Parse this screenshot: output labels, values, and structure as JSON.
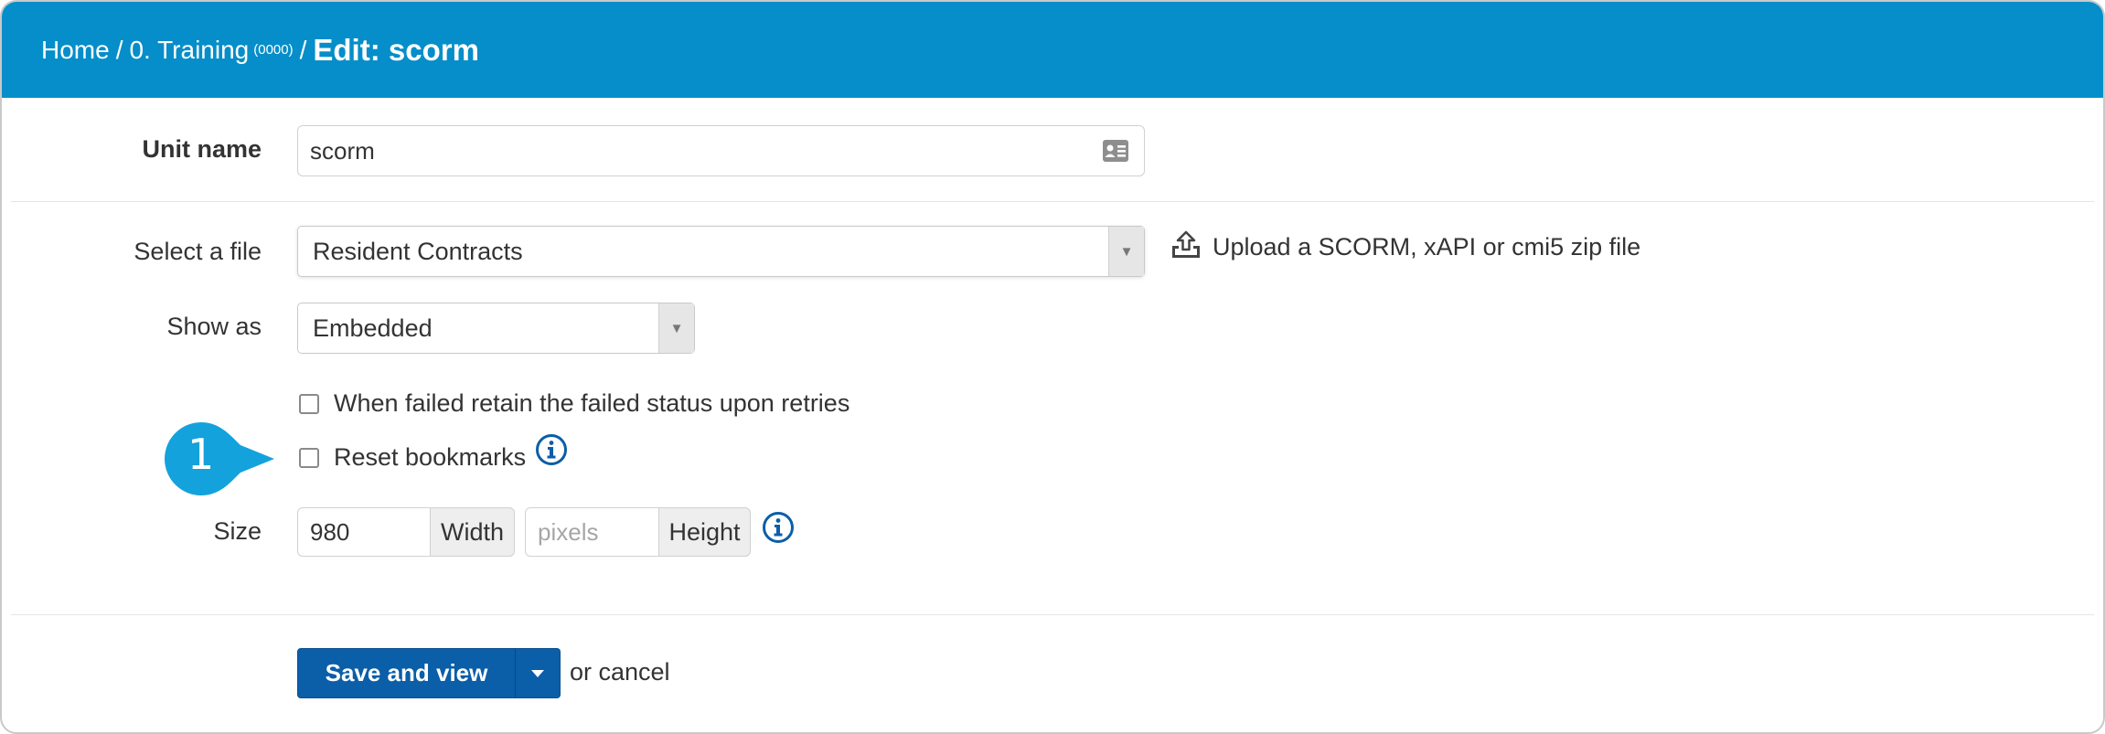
{
  "breadcrumb": {
    "home": "Home",
    "separator": "/",
    "course": "0. Training",
    "course_code": "(0000)",
    "title": "Edit: scorm"
  },
  "unit_name": {
    "label": "Unit name",
    "value": "scorm",
    "icon": "id-card-icon"
  },
  "select_file": {
    "label": "Select a file",
    "value": "Resident Contracts",
    "upload_link": "Upload a SCORM, xAPI or cmi5 zip file"
  },
  "show_as": {
    "label": "Show as",
    "value": "Embedded"
  },
  "options": {
    "retain_failed": "When failed retain the failed status upon retries",
    "reset_bookmarks": "Reset bookmarks"
  },
  "size": {
    "label": "Size",
    "width_value": "980",
    "width_addon": "Width",
    "height_placeholder": "pixels",
    "height_addon": "Height"
  },
  "actions": {
    "save_label": "Save and view",
    "cancel_text": "or cancel"
  },
  "callout": {
    "number": "1"
  },
  "colors": {
    "header": "#058ec9",
    "primary_button": "#0b5ea8",
    "callout": "#13a2dc",
    "info_icon": "#0b5ea8"
  }
}
